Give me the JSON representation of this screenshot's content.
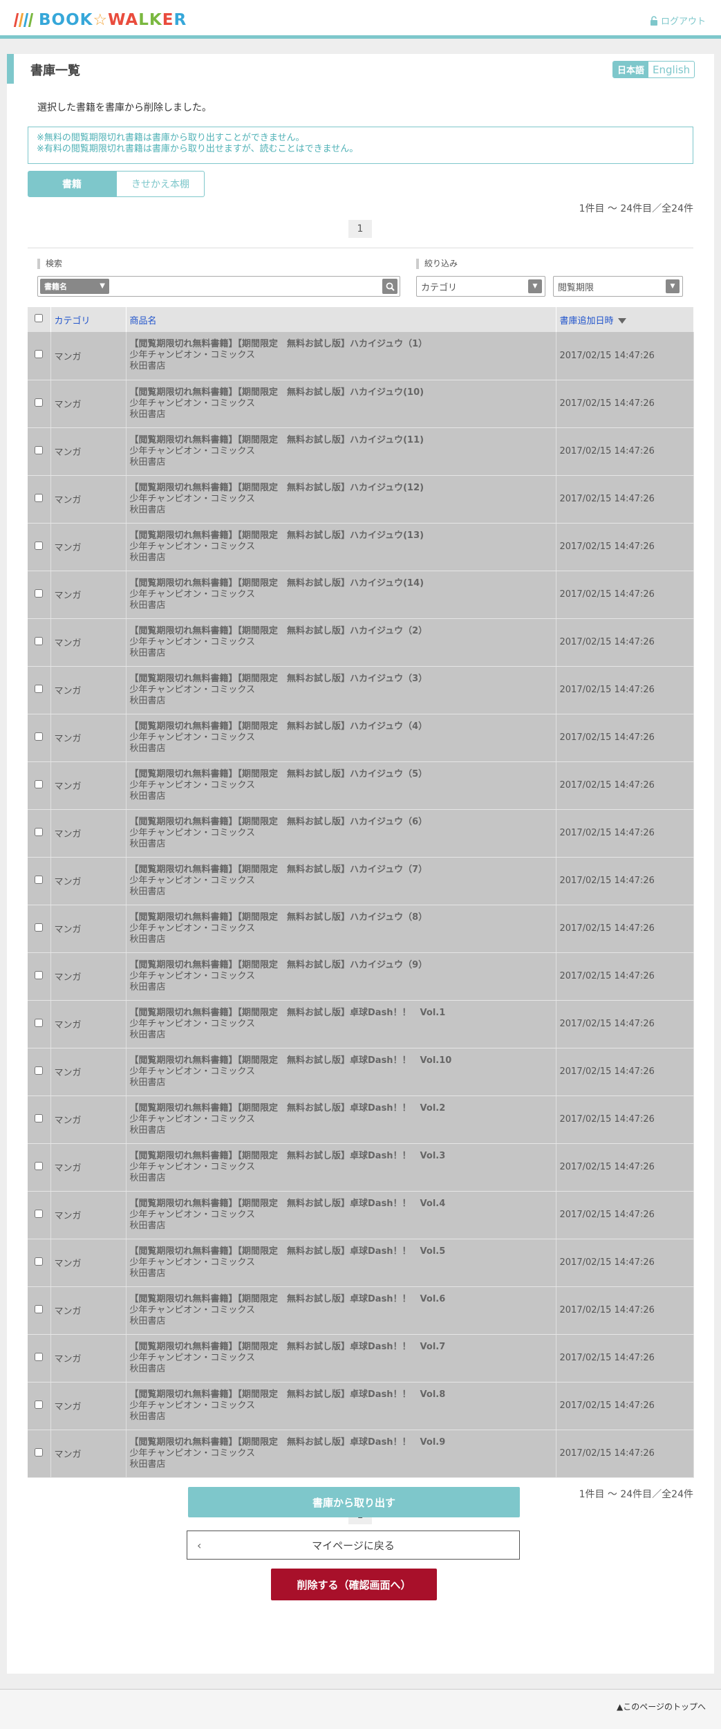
{
  "header": {
    "logo_text": "BOOK☆WALKER",
    "logout_label": "ログアウト",
    "colors": {
      "accent": "#7ec7cb",
      "bar1": "#e94c3d",
      "bar2": "#f3a73b",
      "bar3": "#36a7d9",
      "bar4": "#7ab840",
      "delete": "#a8102a"
    }
  },
  "page": {
    "title": "書庫一覧",
    "lang_ja": "日本語",
    "lang_en": "English",
    "message": "選択した書籍を書庫から削除しました。",
    "notice_lines": [
      "※無料の閲覧期限切れ書籍は書庫から取り出すことができません。",
      "※有料の閲覧期限切れ書籍は書庫から取り出せますが、読むことはできません。"
    ],
    "tabs": [
      {
        "label": "書籍"
      },
      {
        "label": "きせかえ本棚"
      }
    ],
    "count_text": "1件目 〜 24件目／全24件",
    "page_number": "1"
  },
  "filters": {
    "search_label": "検索",
    "search_select": "書籍名",
    "search_placeholder": "",
    "filter_label": "絞り込み",
    "category_select": "カテゴリ",
    "expiry_select": "閲覧期限"
  },
  "table": {
    "headers": {
      "category": "カテゴリ",
      "title": "商品名",
      "date": "書庫追加日時"
    },
    "rows": [
      {
        "category": "マンガ",
        "title": "【閲覧期限切れ無料書籍】【期間限定　無料お試し版】ハカイジュウ（1）",
        "label": "少年チャンピオン・コミックス",
        "publisher": "秋田書店",
        "date": "2017/02/15 14:47:26"
      },
      {
        "category": "マンガ",
        "title": "【閲覧期限切れ無料書籍】【期間限定　無料お試し版】ハカイジュウ(10)",
        "label": "少年チャンピオン・コミックス",
        "publisher": "秋田書店",
        "date": "2017/02/15 14:47:26"
      },
      {
        "category": "マンガ",
        "title": "【閲覧期限切れ無料書籍】【期間限定　無料お試し版】ハカイジュウ(11)",
        "label": "少年チャンピオン・コミックス",
        "publisher": "秋田書店",
        "date": "2017/02/15 14:47:26"
      },
      {
        "category": "マンガ",
        "title": "【閲覧期限切れ無料書籍】【期間限定　無料お試し版】ハカイジュウ(12)",
        "label": "少年チャンピオン・コミックス",
        "publisher": "秋田書店",
        "date": "2017/02/15 14:47:26"
      },
      {
        "category": "マンガ",
        "title": "【閲覧期限切れ無料書籍】【期間限定　無料お試し版】ハカイジュウ(13)",
        "label": "少年チャンピオン・コミックス",
        "publisher": "秋田書店",
        "date": "2017/02/15 14:47:26"
      },
      {
        "category": "マンガ",
        "title": "【閲覧期限切れ無料書籍】【期間限定　無料お試し版】ハカイジュウ(14)",
        "label": "少年チャンピオン・コミックス",
        "publisher": "秋田書店",
        "date": "2017/02/15 14:47:26"
      },
      {
        "category": "マンガ",
        "title": "【閲覧期限切れ無料書籍】【期間限定　無料お試し版】ハカイジュウ（2）",
        "label": "少年チャンピオン・コミックス",
        "publisher": "秋田書店",
        "date": "2017/02/15 14:47:26"
      },
      {
        "category": "マンガ",
        "title": "【閲覧期限切れ無料書籍】【期間限定　無料お試し版】ハカイジュウ（3）",
        "label": "少年チャンピオン・コミックス",
        "publisher": "秋田書店",
        "date": "2017/02/15 14:47:26"
      },
      {
        "category": "マンガ",
        "title": "【閲覧期限切れ無料書籍】【期間限定　無料お試し版】ハカイジュウ（4）",
        "label": "少年チャンピオン・コミックス",
        "publisher": "秋田書店",
        "date": "2017/02/15 14:47:26"
      },
      {
        "category": "マンガ",
        "title": "【閲覧期限切れ無料書籍】【期間限定　無料お試し版】ハカイジュウ（5）",
        "label": "少年チャンピオン・コミックス",
        "publisher": "秋田書店",
        "date": "2017/02/15 14:47:26"
      },
      {
        "category": "マンガ",
        "title": "【閲覧期限切れ無料書籍】【期間限定　無料お試し版】ハカイジュウ（6）",
        "label": "少年チャンピオン・コミックス",
        "publisher": "秋田書店",
        "date": "2017/02/15 14:47:26"
      },
      {
        "category": "マンガ",
        "title": "【閲覧期限切れ無料書籍】【期間限定　無料お試し版】ハカイジュウ（7）",
        "label": "少年チャンピオン・コミックス",
        "publisher": "秋田書店",
        "date": "2017/02/15 14:47:26"
      },
      {
        "category": "マンガ",
        "title": "【閲覧期限切れ無料書籍】【期間限定　無料お試し版】ハカイジュウ（8）",
        "label": "少年チャンピオン・コミックス",
        "publisher": "秋田書店",
        "date": "2017/02/15 14:47:26"
      },
      {
        "category": "マンガ",
        "title": "【閲覧期限切れ無料書籍】【期間限定　無料お試し版】ハカイジュウ（9）",
        "label": "少年チャンピオン・コミックス",
        "publisher": "秋田書店",
        "date": "2017/02/15 14:47:26"
      },
      {
        "category": "マンガ",
        "title": "【閲覧期限切れ無料書籍】【期間限定　無料お試し版】卓球Dash！！　Vol.1",
        "label": "少年チャンピオン・コミックス",
        "publisher": "秋田書店",
        "date": "2017/02/15 14:47:26"
      },
      {
        "category": "マンガ",
        "title": "【閲覧期限切れ無料書籍】【期間限定　無料お試し版】卓球Dash！！　Vol.10",
        "label": "少年チャンピオン・コミックス",
        "publisher": "秋田書店",
        "date": "2017/02/15 14:47:26"
      },
      {
        "category": "マンガ",
        "title": "【閲覧期限切れ無料書籍】【期間限定　無料お試し版】卓球Dash！！　Vol.2",
        "label": "少年チャンピオン・コミックス",
        "publisher": "秋田書店",
        "date": "2017/02/15 14:47:26"
      },
      {
        "category": "マンガ",
        "title": "【閲覧期限切れ無料書籍】【期間限定　無料お試し版】卓球Dash！！　Vol.3",
        "label": "少年チャンピオン・コミックス",
        "publisher": "秋田書店",
        "date": "2017/02/15 14:47:26"
      },
      {
        "category": "マンガ",
        "title": "【閲覧期限切れ無料書籍】【期間限定　無料お試し版】卓球Dash！！　Vol.4",
        "label": "少年チャンピオン・コミックス",
        "publisher": "秋田書店",
        "date": "2017/02/15 14:47:26"
      },
      {
        "category": "マンガ",
        "title": "【閲覧期限切れ無料書籍】【期間限定　無料お試し版】卓球Dash！！　Vol.5",
        "label": "少年チャンピオン・コミックス",
        "publisher": "秋田書店",
        "date": "2017/02/15 14:47:26"
      },
      {
        "category": "マンガ",
        "title": "【閲覧期限切れ無料書籍】【期間限定　無料お試し版】卓球Dash！！　Vol.6",
        "label": "少年チャンピオン・コミックス",
        "publisher": "秋田書店",
        "date": "2017/02/15 14:47:26"
      },
      {
        "category": "マンガ",
        "title": "【閲覧期限切れ無料書籍】【期間限定　無料お試し版】卓球Dash！！　Vol.7",
        "label": "少年チャンピオン・コミックス",
        "publisher": "秋田書店",
        "date": "2017/02/15 14:47:26"
      },
      {
        "category": "マンガ",
        "title": "【閲覧期限切れ無料書籍】【期間限定　無料お試し版】卓球Dash！！　Vol.8",
        "label": "少年チャンピオン・コミックス",
        "publisher": "秋田書店",
        "date": "2017/02/15 14:47:26"
      },
      {
        "category": "マンガ",
        "title": "【閲覧期限切れ無料書籍】【期間限定　無料お試し版】卓球Dash！！　Vol.9",
        "label": "少年チャンピオン・コミックス",
        "publisher": "秋田書店",
        "date": "2017/02/15 14:47:26"
      }
    ]
  },
  "actions": {
    "take_out_label": "書庫から取り出す",
    "back_label": "マイページに戻る",
    "delete_label": "削除する（確認画面へ）"
  },
  "footer": {
    "page_top_label": "▲このページのトップへ"
  }
}
